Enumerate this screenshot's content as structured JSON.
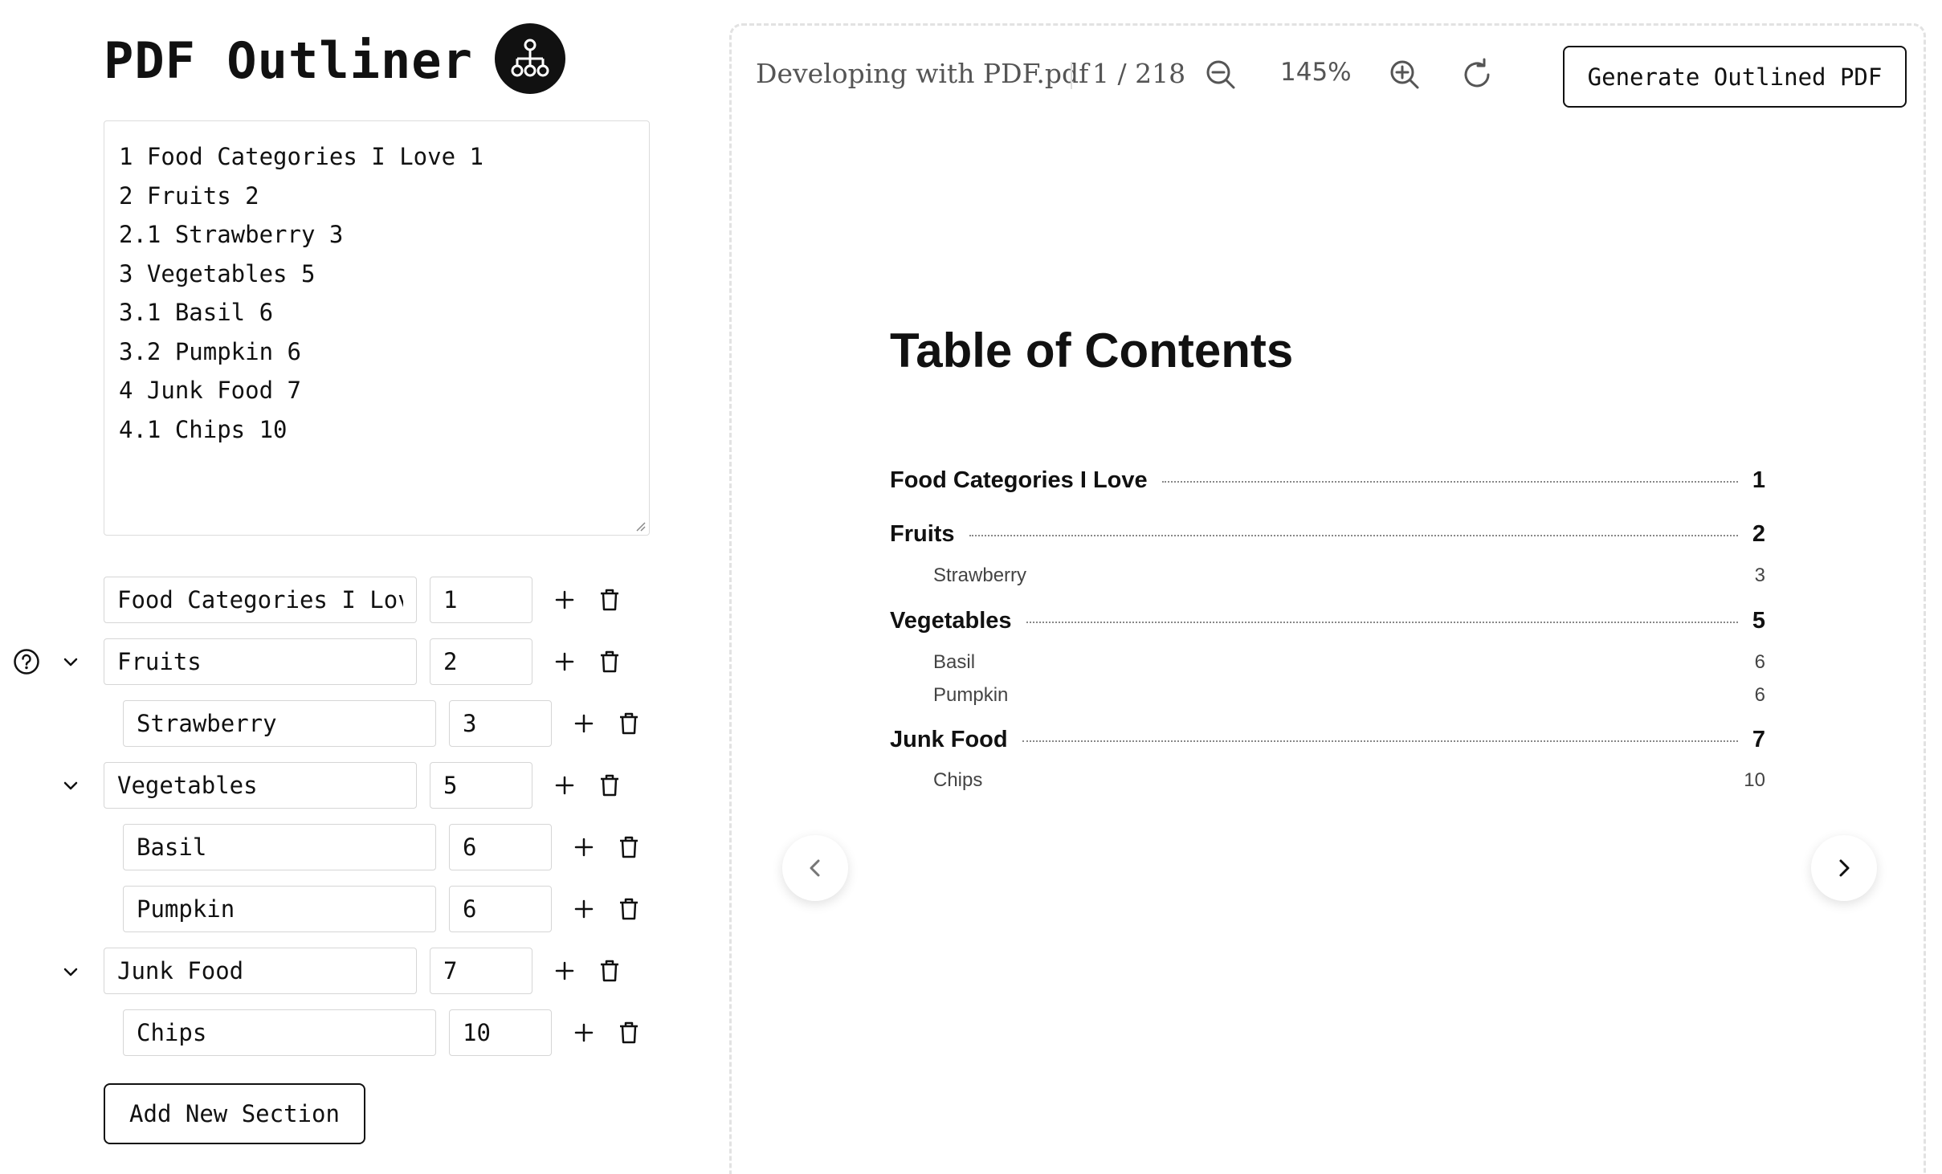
{
  "app": {
    "title": "PDF Outliner",
    "logo_icon": "hierarchy-icon"
  },
  "editor": {
    "text": "1 Food Categories I Love 1\n2 Fruits 2\n2.1 Strawberry 3\n3 Vegetables 5\n3.1 Basil 6\n3.2 Pumpkin 6\n4 Junk Food 7\n4.1 Chips 10"
  },
  "sections": [
    {
      "title": "Food Categories I Love",
      "page": "1"
    },
    {
      "title": "Fruits",
      "page": "2"
    },
    {
      "title": "Strawberry",
      "page": "3"
    },
    {
      "title": "Vegetables",
      "page": "5"
    },
    {
      "title": "Basil",
      "page": "6"
    },
    {
      "title": "Pumpkin",
      "page": "6"
    },
    {
      "title": "Junk Food",
      "page": "7"
    },
    {
      "title": "Chips",
      "page": "10"
    }
  ],
  "add_section_label": "Add New Section",
  "viewer": {
    "file_name": "Developing with PDF.pdf",
    "page_indicator": "1 / 218",
    "zoom": "145%",
    "generate_label": "Generate Outlined PDF"
  },
  "pdf": {
    "toc_title": "Table of Contents",
    "entries": [
      {
        "title": "Food Categories I Love",
        "page": "1"
      },
      {
        "title": "Fruits",
        "page": "2"
      },
      {
        "title": "Strawberry",
        "page": "3"
      },
      {
        "title": "Vegetables",
        "page": "5"
      },
      {
        "title": "Basil",
        "page": "6"
      },
      {
        "title": "Pumpkin",
        "page": "6"
      },
      {
        "title": "Junk Food",
        "page": "7"
      },
      {
        "title": "Chips",
        "page": "10"
      }
    ]
  }
}
